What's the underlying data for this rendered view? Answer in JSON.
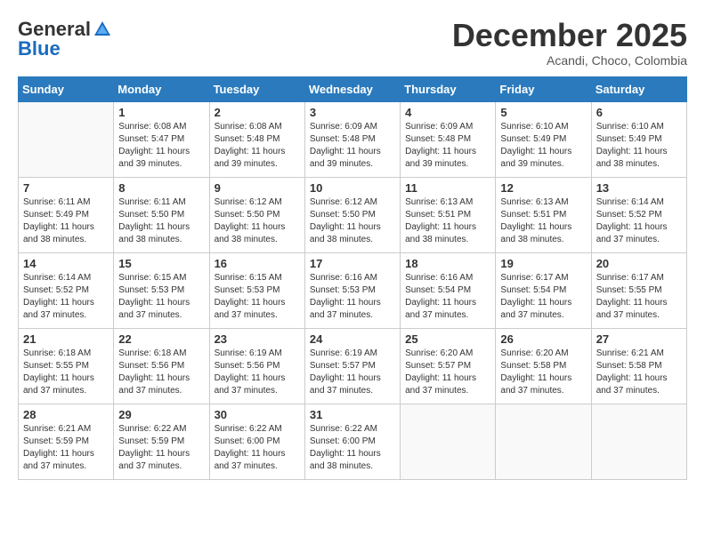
{
  "header": {
    "logo_general": "General",
    "logo_blue": "Blue",
    "month_title": "December 2025",
    "subtitle": "Acandi, Choco, Colombia"
  },
  "calendar": {
    "days_of_week": [
      "Sunday",
      "Monday",
      "Tuesday",
      "Wednesday",
      "Thursday",
      "Friday",
      "Saturday"
    ],
    "weeks": [
      [
        {
          "day": "",
          "sunrise": "",
          "sunset": "",
          "daylight": ""
        },
        {
          "day": "1",
          "sunrise": "6:08 AM",
          "sunset": "5:47 PM",
          "daylight": "11 hours and 39 minutes."
        },
        {
          "day": "2",
          "sunrise": "6:08 AM",
          "sunset": "5:48 PM",
          "daylight": "11 hours and 39 minutes."
        },
        {
          "day": "3",
          "sunrise": "6:09 AM",
          "sunset": "5:48 PM",
          "daylight": "11 hours and 39 minutes."
        },
        {
          "day": "4",
          "sunrise": "6:09 AM",
          "sunset": "5:48 PM",
          "daylight": "11 hours and 39 minutes."
        },
        {
          "day": "5",
          "sunrise": "6:10 AM",
          "sunset": "5:49 PM",
          "daylight": "11 hours and 39 minutes."
        },
        {
          "day": "6",
          "sunrise": "6:10 AM",
          "sunset": "5:49 PM",
          "daylight": "11 hours and 38 minutes."
        }
      ],
      [
        {
          "day": "7",
          "sunrise": "6:11 AM",
          "sunset": "5:49 PM",
          "daylight": "11 hours and 38 minutes."
        },
        {
          "day": "8",
          "sunrise": "6:11 AM",
          "sunset": "5:50 PM",
          "daylight": "11 hours and 38 minutes."
        },
        {
          "day": "9",
          "sunrise": "6:12 AM",
          "sunset": "5:50 PM",
          "daylight": "11 hours and 38 minutes."
        },
        {
          "day": "10",
          "sunrise": "6:12 AM",
          "sunset": "5:50 PM",
          "daylight": "11 hours and 38 minutes."
        },
        {
          "day": "11",
          "sunrise": "6:13 AM",
          "sunset": "5:51 PM",
          "daylight": "11 hours and 38 minutes."
        },
        {
          "day": "12",
          "sunrise": "6:13 AM",
          "sunset": "5:51 PM",
          "daylight": "11 hours and 38 minutes."
        },
        {
          "day": "13",
          "sunrise": "6:14 AM",
          "sunset": "5:52 PM",
          "daylight": "11 hours and 37 minutes."
        }
      ],
      [
        {
          "day": "14",
          "sunrise": "6:14 AM",
          "sunset": "5:52 PM",
          "daylight": "11 hours and 37 minutes."
        },
        {
          "day": "15",
          "sunrise": "6:15 AM",
          "sunset": "5:53 PM",
          "daylight": "11 hours and 37 minutes."
        },
        {
          "day": "16",
          "sunrise": "6:15 AM",
          "sunset": "5:53 PM",
          "daylight": "11 hours and 37 minutes."
        },
        {
          "day": "17",
          "sunrise": "6:16 AM",
          "sunset": "5:53 PM",
          "daylight": "11 hours and 37 minutes."
        },
        {
          "day": "18",
          "sunrise": "6:16 AM",
          "sunset": "5:54 PM",
          "daylight": "11 hours and 37 minutes."
        },
        {
          "day": "19",
          "sunrise": "6:17 AM",
          "sunset": "5:54 PM",
          "daylight": "11 hours and 37 minutes."
        },
        {
          "day": "20",
          "sunrise": "6:17 AM",
          "sunset": "5:55 PM",
          "daylight": "11 hours and 37 minutes."
        }
      ],
      [
        {
          "day": "21",
          "sunrise": "6:18 AM",
          "sunset": "5:55 PM",
          "daylight": "11 hours and 37 minutes."
        },
        {
          "day": "22",
          "sunrise": "6:18 AM",
          "sunset": "5:56 PM",
          "daylight": "11 hours and 37 minutes."
        },
        {
          "day": "23",
          "sunrise": "6:19 AM",
          "sunset": "5:56 PM",
          "daylight": "11 hours and 37 minutes."
        },
        {
          "day": "24",
          "sunrise": "6:19 AM",
          "sunset": "5:57 PM",
          "daylight": "11 hours and 37 minutes."
        },
        {
          "day": "25",
          "sunrise": "6:20 AM",
          "sunset": "5:57 PM",
          "daylight": "11 hours and 37 minutes."
        },
        {
          "day": "26",
          "sunrise": "6:20 AM",
          "sunset": "5:58 PM",
          "daylight": "11 hours and 37 minutes."
        },
        {
          "day": "27",
          "sunrise": "6:21 AM",
          "sunset": "5:58 PM",
          "daylight": "11 hours and 37 minutes."
        }
      ],
      [
        {
          "day": "28",
          "sunrise": "6:21 AM",
          "sunset": "5:59 PM",
          "daylight": "11 hours and 37 minutes."
        },
        {
          "day": "29",
          "sunrise": "6:22 AM",
          "sunset": "5:59 PM",
          "daylight": "11 hours and 37 minutes."
        },
        {
          "day": "30",
          "sunrise": "6:22 AM",
          "sunset": "6:00 PM",
          "daylight": "11 hours and 37 minutes."
        },
        {
          "day": "31",
          "sunrise": "6:22 AM",
          "sunset": "6:00 PM",
          "daylight": "11 hours and 38 minutes."
        },
        {
          "day": "",
          "sunrise": "",
          "sunset": "",
          "daylight": ""
        },
        {
          "day": "",
          "sunrise": "",
          "sunset": "",
          "daylight": ""
        },
        {
          "day": "",
          "sunrise": "",
          "sunset": "",
          "daylight": ""
        }
      ]
    ]
  }
}
